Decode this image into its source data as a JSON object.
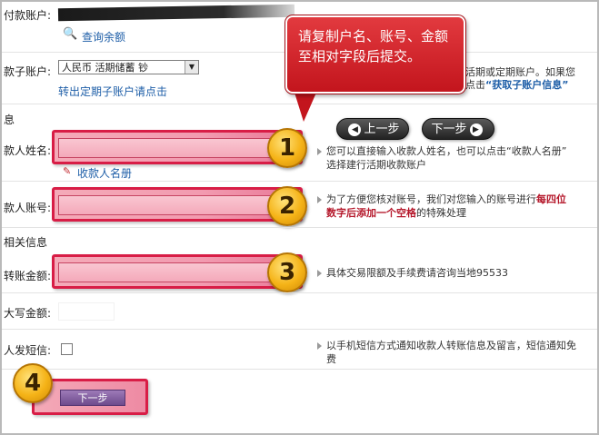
{
  "labels": {
    "pay_account": "付款账户:",
    "sub_account": "款子账户:",
    "section_payee": "息",
    "payee_name": "款人姓名:",
    "payee_account": "款人账号:",
    "section_related": "相关信息",
    "transfer_amount": "转账金额:",
    "amount_upper": "大写金额:",
    "sms": "人发短信:"
  },
  "links": {
    "query_balance": "查询余额",
    "transfer_out": "转出定期子账户请点击",
    "payee_book": "收款人名册",
    "get_sub_account": "“获取子账户信息”"
  },
  "select": {
    "value": "人民币 活期储蓄 钞",
    "arrow": "▼"
  },
  "notes": {
    "sub_account_l1": "活期或定期账户。如果您",
    "sub_account_l2": "点击",
    "name_l1": "您可以直接输入收款人姓名，也可以点击“收款人名册”",
    "name_l2": "选择建行活期收款账户",
    "acct_l1a": "为了方便您核对账号，我们对您输入的账号进行",
    "acct_l1b": "每四位",
    "acct_l2a": "数字后添加一个空格",
    "acct_l2b": "的特殊处理",
    "amount": "具体交易限额及手续费请咨询当地95533",
    "sms_l1": "以手机短信方式通知收款人转账信息及留言，短信通知免",
    "sms_l2": "费"
  },
  "callout": {
    "text": "请复制户名、账号、金额至相对字段后提交。"
  },
  "nav": {
    "prev": "上一步",
    "next": "下一步",
    "prev_icon": "◀",
    "next_icon": "▶"
  },
  "steps": [
    "1",
    "2",
    "3",
    "4"
  ],
  "submit": {
    "label": "下一步"
  },
  "colors": {
    "highlight": "#d81d46",
    "callout": "#c3151d",
    "link": "#1f5fa8",
    "badge": "#f5b317"
  }
}
